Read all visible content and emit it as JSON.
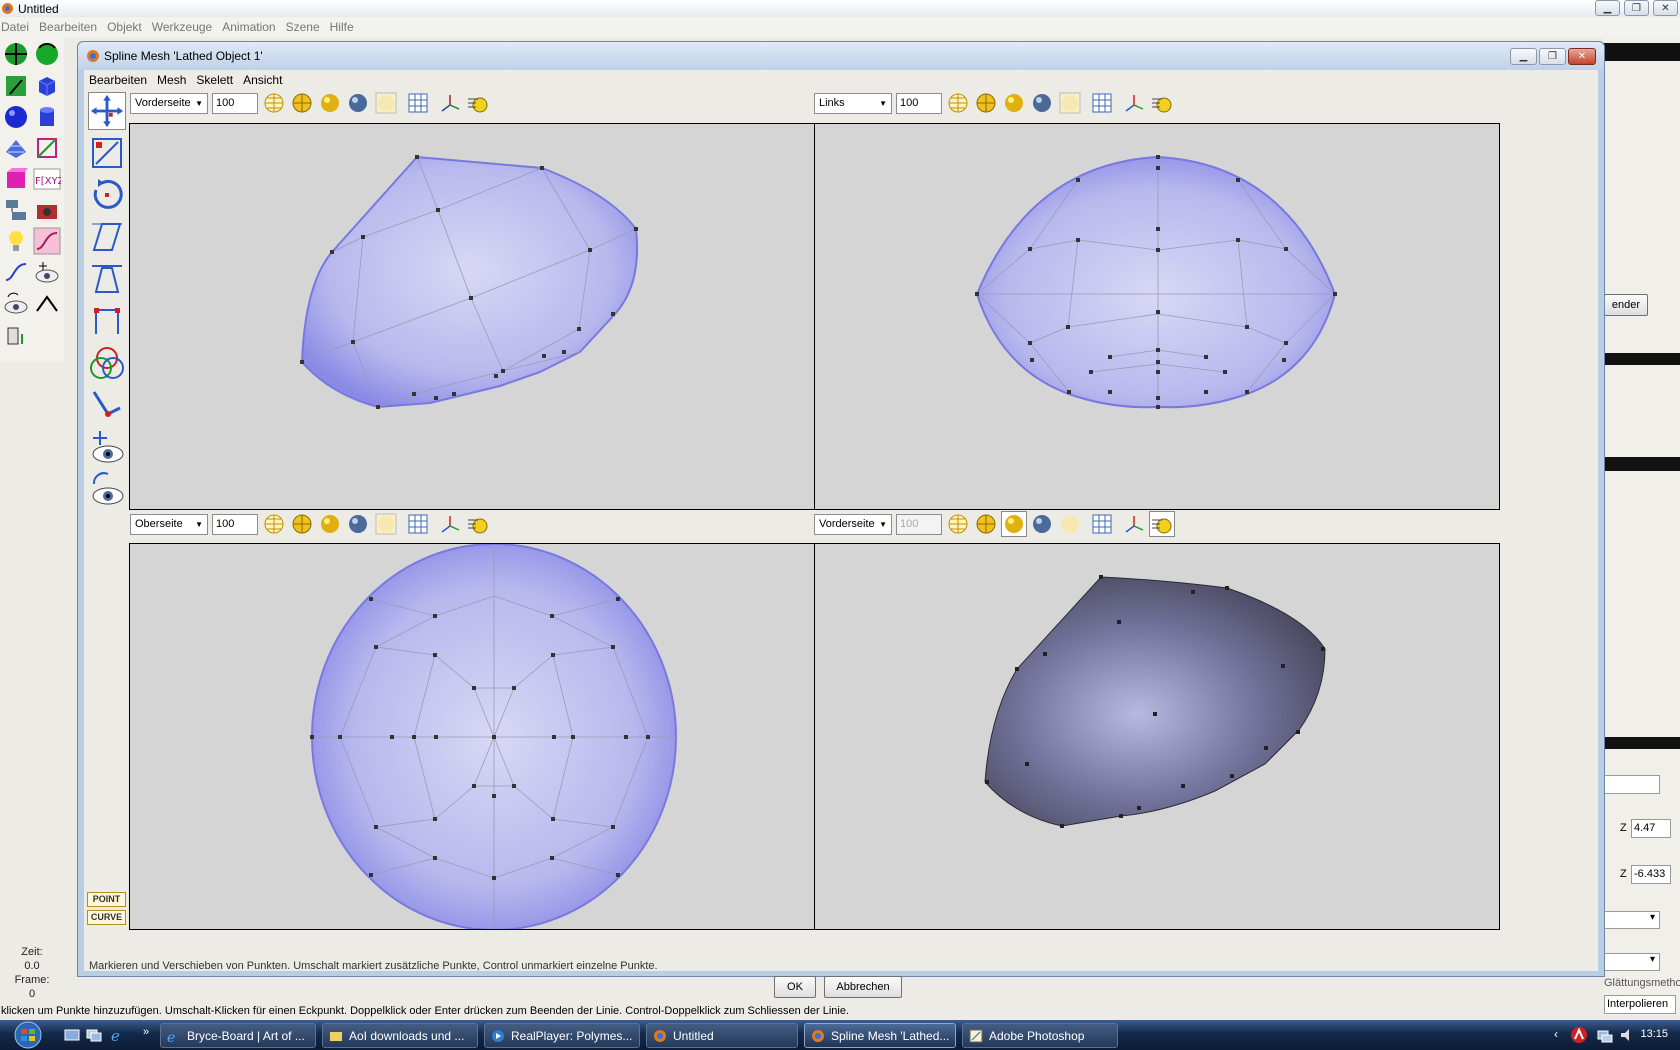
{
  "app": {
    "title": "Untitled",
    "menu": [
      "Datei",
      "Bearbeiten",
      "Objekt",
      "Werkzeuge",
      "Animation",
      "Szene",
      "Hilfe"
    ],
    "status_bar": "klicken um Punkte hinzuzufügen. Umschalt-Klicken für einen Eckpunkt. Doppelklick oder Enter drücken zum Beenden der Linie. Control-Doppelklick zum Schliessen der Linie.",
    "time_label": "Zeit:",
    "time_value": "0.0",
    "frame_label": "Frame:",
    "frame_value": "0"
  },
  "right_panel": {
    "render_button": "ender",
    "z1_label": "Z",
    "z1_value": "4.47",
    "z2_label": "Z",
    "z2_value": "-6.433",
    "smoothing_label": "Glättungsmethode",
    "smoothing_value": "Interpolieren"
  },
  "dialog": {
    "title": "Spline Mesh 'Lathed Object 1'",
    "menu": [
      "Bearbeiten",
      "Mesh",
      "Skelett",
      "Ansicht"
    ],
    "mode_point": "POINT",
    "mode_curve": "CURVE",
    "hint": "Markieren und Verschieben von Punkten. Umschalt markiert zusätzliche Punkte, Control unmarkiert einzelne Punkte.",
    "ok_button": "OK",
    "cancel_button": "Abbrechen",
    "views": [
      {
        "view": "Vorderseite",
        "zoom": "100"
      },
      {
        "view": "Links",
        "zoom": "100"
      },
      {
        "view": "Oberseite",
        "zoom": "100"
      },
      {
        "view": "Vorderseite",
        "zoom": "100"
      }
    ],
    "mesh_color": "#8f8fe8",
    "shaded_color": "#5a5a72"
  },
  "taskbar": {
    "tasks": [
      {
        "label": "Bryce-Board | Art of ...",
        "icon": "ie-icon"
      },
      {
        "label": "AoI downloads und ...",
        "icon": "folder-icon"
      },
      {
        "label": "RealPlayer: Polymes...",
        "icon": "realplayer-icon"
      },
      {
        "label": "Untitled",
        "icon": "aoi-icon"
      },
      {
        "label": "Spline Mesh 'Lathed...",
        "icon": "aoi-icon"
      },
      {
        "label": "Adobe Photoshop",
        "icon": "photoshop-icon"
      }
    ],
    "clock": "13:15"
  }
}
